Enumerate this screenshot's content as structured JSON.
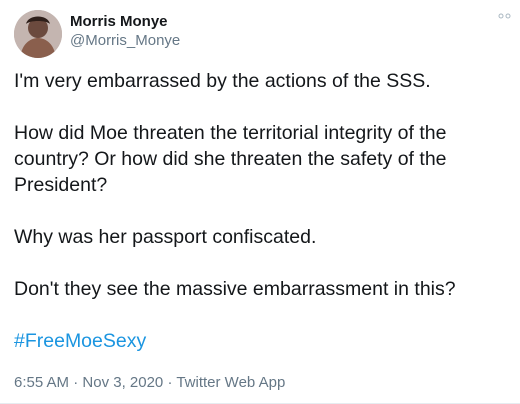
{
  "author": {
    "name": "Morris Monye",
    "handle": "@Morris_Monye",
    "avatar_icon": "profile-photo-avatar"
  },
  "menu": {
    "icon": "more-options-icon"
  },
  "tweet": {
    "paragraphs": [
      "I'm very embarrassed by the actions of the SSS.",
      "How did Moe threaten the territorial integrity of the\ncountry? Or how did she threaten the safety of the\nPresident?",
      "Why was her passport confiscated.",
      "Don't they see the massive embarrassment in this?"
    ],
    "hashtag": "#FreeMoeSexy"
  },
  "meta": {
    "time": "6:55 AM",
    "separator1": " · ",
    "date": "Nov 3, 2020",
    "separator2": " · ",
    "source": "Twitter Web App"
  },
  "colors": {
    "link": "#1b95e0",
    "secondary_text": "#657786",
    "primary_text": "#14171a"
  }
}
